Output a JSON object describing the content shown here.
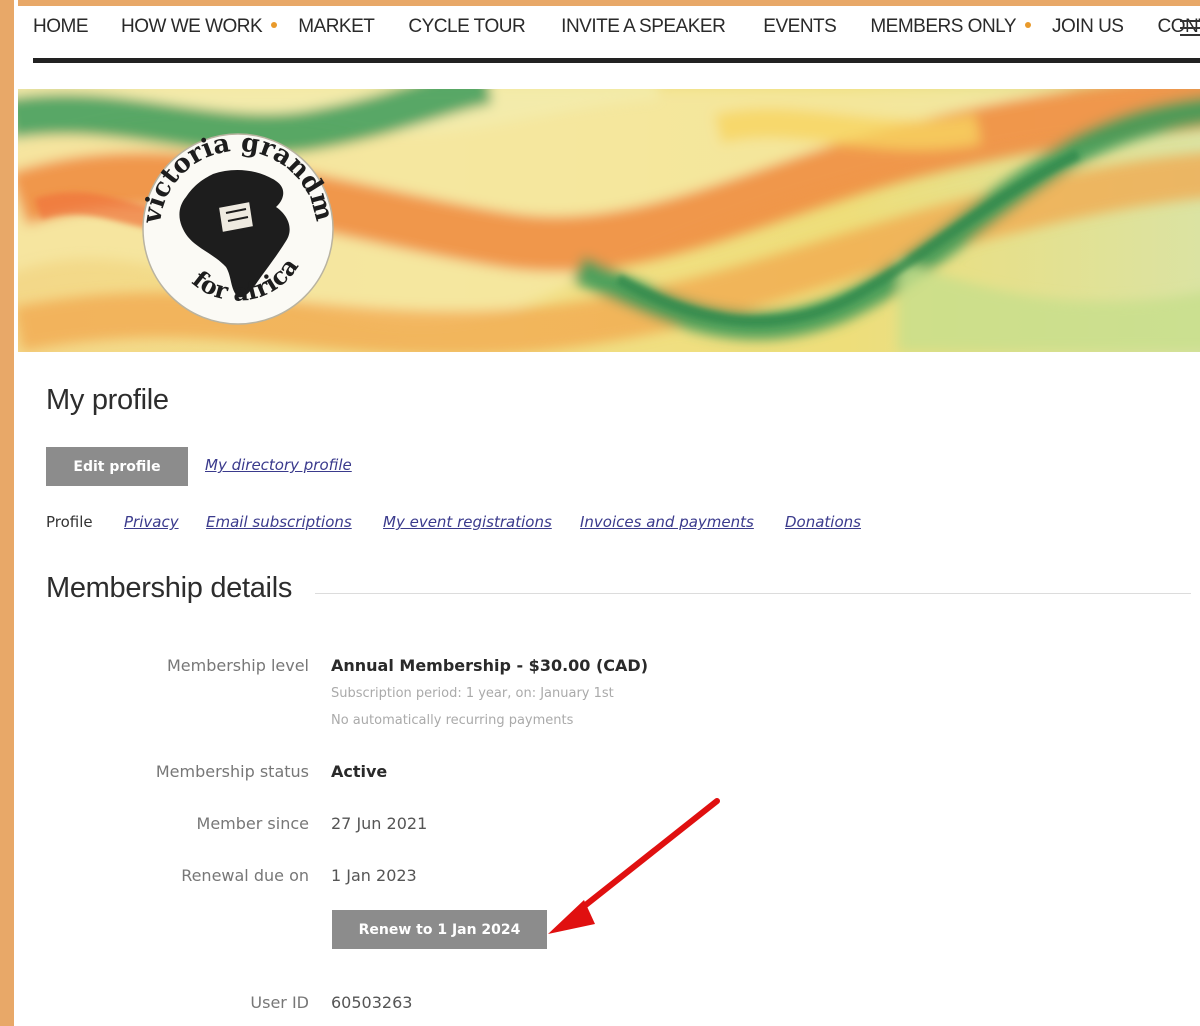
{
  "nav": {
    "items": [
      {
        "label": "HOME",
        "dot": false
      },
      {
        "label": "HOW WE WORK",
        "dot": true
      },
      {
        "label": "MARKET",
        "dot": false
      },
      {
        "label": "CYCLE TOUR",
        "dot": false
      },
      {
        "label": "INVITE A SPEAKER",
        "dot": false
      },
      {
        "label": "EVENTS",
        "dot": false
      },
      {
        "label": "MEMBERS ONLY",
        "dot": true
      },
      {
        "label": "JOIN US",
        "dot": false
      },
      {
        "label": "CONTACT",
        "dot": false
      }
    ],
    "menu_icon": "hamburger-menu-icon",
    "dot_color": "#e99a2b"
  },
  "banner": {
    "logo_text_top": "victoria grandmothers",
    "logo_text_bottom": "for africa"
  },
  "profile": {
    "title": "My profile",
    "edit_button": "Edit profile",
    "directory_link": "My directory profile",
    "tabs": {
      "current": "Profile",
      "links": [
        "Privacy",
        "Email subscriptions",
        "My event registrations",
        "Invoices and payments",
        "Donations"
      ]
    }
  },
  "membership": {
    "title": "Membership details",
    "level_label": "Membership level",
    "level_value": "Annual Membership - $30.00 (CAD)",
    "subscription_period": "Subscription period: 1 year, on: January 1st",
    "recurring_note": "No automatically recurring payments",
    "status_label": "Membership status",
    "status_value": "Active",
    "since_label": "Member since",
    "since_value": "27 Jun 2021",
    "renewal_label": "Renewal due on",
    "renewal_value": "1 Jan 2023",
    "renew_button": "Renew to 1 Jan 2024",
    "userid_label": "User ID",
    "userid_value": "60503263"
  },
  "colors": {
    "frame": "#e8a868",
    "button": "#8c8c8c",
    "link": "#3a3a8c",
    "arrow": "#e01010"
  }
}
